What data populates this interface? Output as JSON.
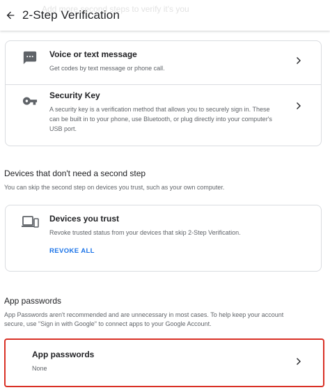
{
  "header": {
    "title": "2-Step Verification",
    "ghost_text": "Add more second steps to verify it's you"
  },
  "methods": {
    "voice": {
      "title": "Voice or text message",
      "description": "Get codes by text message or phone call."
    },
    "security_key": {
      "title": "Security Key",
      "description_lines": [
        "A security key is a verification method that allows you to securely sign in. These",
        "can be built in to your phone, use Bluetooth, or plug directly into your computer's",
        "USB port."
      ]
    }
  },
  "devices_section": {
    "title": "Devices that don't need a second step",
    "subtitle": "You can skip the second step on devices you trust, such as your own computer."
  },
  "trusted_devices": {
    "title": "Devices you trust",
    "description": "Revoke trusted status from your devices that skip 2-Step Verification.",
    "action": "REVOKE ALL"
  },
  "app_passwords_section": {
    "title": "App passwords",
    "subtitle_lines": [
      "App Passwords aren't recommended and are unnecessary in most cases. To help keep your account",
      "secure, use \"Sign in with Google\" to connect apps to your Google Account."
    ]
  },
  "app_passwords_card": {
    "title": "App passwords",
    "value": "None"
  },
  "colors": {
    "accent": "#1a73e8",
    "highlight_border": "#d93025",
    "icon": "#5f6368",
    "text": "#202124",
    "secondary_text": "#5f6368"
  }
}
